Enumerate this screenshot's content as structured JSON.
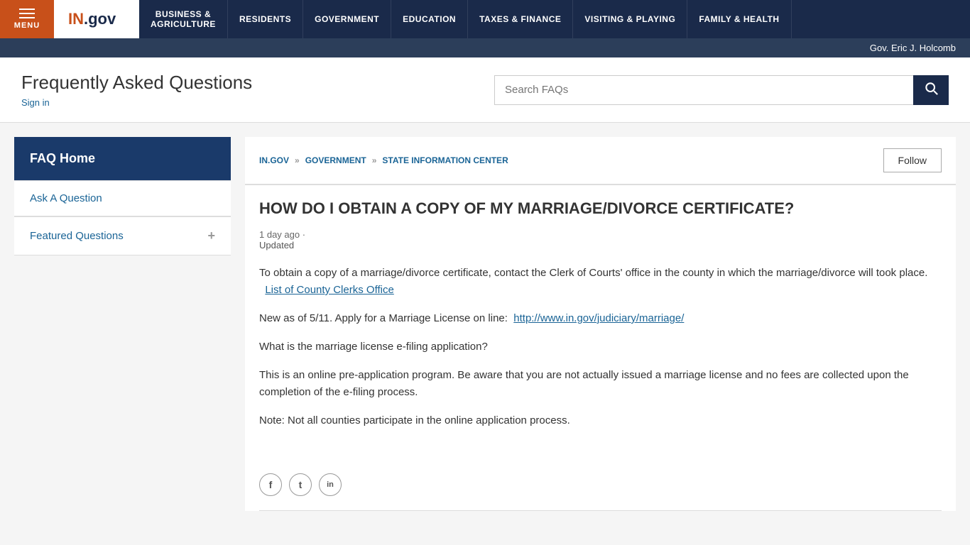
{
  "topnav": {
    "menu_label": "MENU",
    "logo": "IN.gov",
    "items": [
      {
        "label": "BUSINESS &\nAGRICULTURE"
      },
      {
        "label": "RESIDENTS"
      },
      {
        "label": "GOVERNMENT"
      },
      {
        "label": "EDUCATION"
      },
      {
        "label": "TAXES & FINANCE"
      },
      {
        "label": "VISITING & PLAYING"
      },
      {
        "label": "FAMILY & HEALTH"
      }
    ],
    "gov_banner": "Gov. Eric J. Holcomb"
  },
  "header": {
    "title": "Frequently Asked Questions",
    "signin_label": "Sign in",
    "search_placeholder": "Search FAQs"
  },
  "sidebar": {
    "home_label": "FAQ Home",
    "ask_label": "Ask A Question",
    "featured_label": "Featured Questions",
    "featured_icon": "+"
  },
  "breadcrumb": {
    "items": [
      {
        "label": "IN.GOV"
      },
      {
        "label": "GOVERNMENT"
      },
      {
        "label": "STATE INFORMATION CENTER"
      }
    ],
    "follow_label": "Follow"
  },
  "article": {
    "title": "HOW DO I OBTAIN A COPY OF MY MARRIAGE/DIVORCE CERTIFICATE?",
    "date": "1 day ago  ·",
    "updated": "Updated",
    "paragraphs": [
      "To obtain a copy of  a marriage/divorce certificate, contact the Clerk of Courts' office in the county in which the marriage/divorce will took place.",
      "New as of 5/11.  Apply for a Marriage License on line:",
      "What is the marriage license e-filing application?",
      "This is an online pre-application program. Be aware that you are not actually issued a marriage license and no fees are collected upon the completion of the e-filing process.",
      "Note: Not all counties participate in the online application process."
    ],
    "link1_text": "List of County Clerks Office",
    "link1_url": "#",
    "link2_text": "http://www.in.gov/judiciary/marriage/",
    "link2_url": "#"
  },
  "social": {
    "icons": [
      {
        "name": "facebook",
        "symbol": "f"
      },
      {
        "name": "twitter",
        "symbol": "t"
      },
      {
        "name": "linkedin",
        "symbol": "in"
      }
    ]
  }
}
